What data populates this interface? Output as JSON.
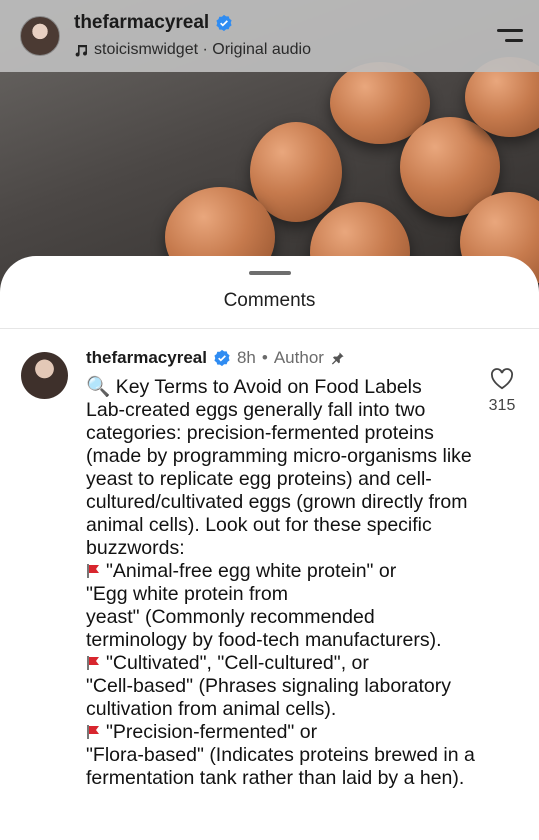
{
  "header": {
    "username": "thefarmacyreal",
    "verified": true,
    "audio_label": "stoicismwidget · Original audio"
  },
  "sheet": {
    "title": "Comments"
  },
  "comment": {
    "username": "thefarmacyreal",
    "time": "8h",
    "separator": "•",
    "role": "Author",
    "likes": "315",
    "line_title": "🔍 Key Terms to Avoid on Food Labels",
    "para_intro": "Lab-created eggs generally fall into two categories: precision-fermented proteins (made by programming micro-organisms like yeast to replicate egg proteins) and cell-cultured/cultivated eggs (grown directly from animal cells). Look out for these specific buzzwords:",
    "item1_a": "\"Animal-free egg white protein\" or",
    "item1_b": "\"Egg white protein from",
    "item1_c": "yeast\" (Commonly recommended terminology by food-tech manufacturers).",
    "item2_a": "\"Cultivated\", \"Cell-cultured\", or",
    "item2_b": "\"Cell-based\" (Phrases signaling laboratory cultivation from animal cells).",
    "item3_a": "\"Precision-fermented\" or",
    "item3_b": "\"Flora-based\" (Indicates proteins brewed in a fermentation tank rather than laid by a hen)."
  },
  "colors": {
    "verified_badge": "#2f8cf2",
    "flag": "#d8262e"
  }
}
